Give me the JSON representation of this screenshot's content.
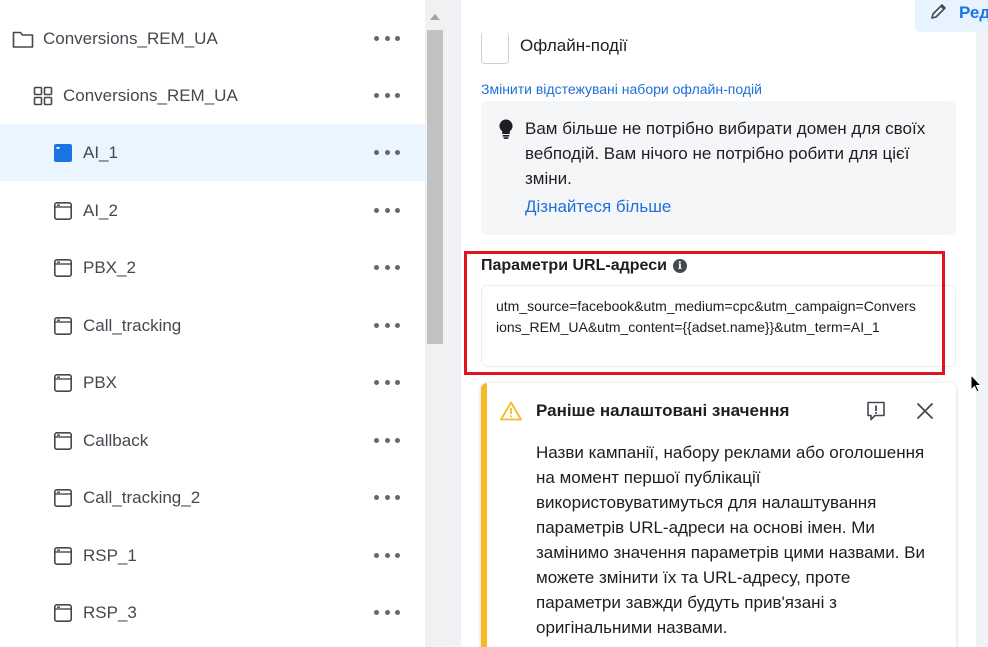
{
  "tree": {
    "rows": [
      {
        "label": "Conversions_REM_UA",
        "type": "campaign"
      },
      {
        "label": "Conversions_REM_UA",
        "type": "adset"
      },
      {
        "label": "AI_1",
        "type": "ad",
        "selected": true
      },
      {
        "label": "AI_2",
        "type": "ad"
      },
      {
        "label": "PBX_2",
        "type": "ad"
      },
      {
        "label": "Call_tracking",
        "type": "ad"
      },
      {
        "label": "PBX",
        "type": "ad"
      },
      {
        "label": "Callback",
        "type": "ad"
      },
      {
        "label": "Call_tracking_2",
        "type": "ad"
      },
      {
        "label": "RSP_1",
        "type": "ad"
      },
      {
        "label": "RSP_3",
        "type": "ad"
      }
    ]
  },
  "header": {
    "edit_label": "Ред"
  },
  "offline": {
    "checkbox_label": "Офлайн-події",
    "change_link": "Змінити відстежувані набори офлайн-подій"
  },
  "info": {
    "text": "Вам більше не потрібно вибирати домен для своїх вебподій. Вам нічого не потрібно робити для цієї зміни.",
    "link": "Дізнайтеся більше"
  },
  "url_params": {
    "title": "Параметри URL-адреси",
    "info_glyph": "i",
    "value": "utm_source=facebook&utm_medium=cpc&utm_campaign=Conversions_REM_UA&utm_content={{adset.name}}&utm_term=AI_1"
  },
  "warning": {
    "title": "Раніше налаштовані значення",
    "text": "Назви кампанії, набору реклами або оголошення на момент першої публікації використовуватимуться для налаштування параметрів URL-адреси на основі імен. Ми замінимо значення параметрів цими назвами. Ви можете змінити їх та URL-адресу, проте параметри завжди будуть прив'язані з оригінальними назвами."
  },
  "colors": {
    "accent": "#216fdb",
    "selected_row": "#ebf5ff",
    "highlight_frame": "#e0141e",
    "warning": "#f7b928"
  }
}
